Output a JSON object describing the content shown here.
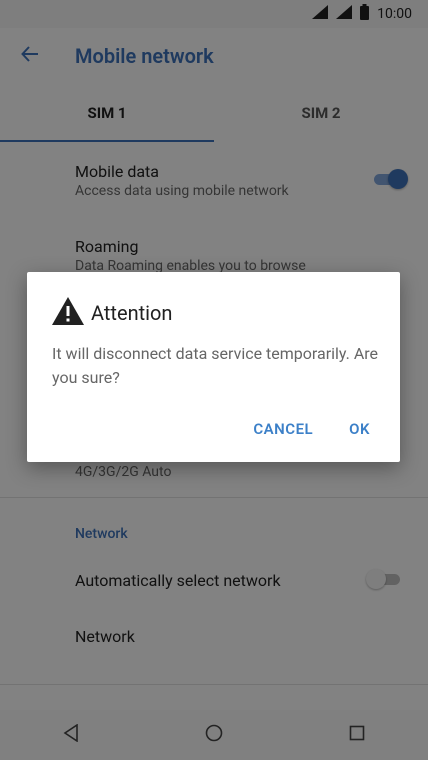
{
  "status_bar": {
    "time": "10:00",
    "icons": [
      "signal-icon",
      "signal-icon",
      "battery-icon"
    ]
  },
  "app_bar": {
    "back_icon": "arrow-left-icon",
    "title": "Mobile network"
  },
  "tabs": [
    {
      "label": "SIM 1",
      "active": true
    },
    {
      "label": "SIM 2",
      "active": false
    }
  ],
  "settings": {
    "mobile_data": {
      "title": "Mobile data",
      "subtitle": "Access data using mobile network",
      "toggle_on": true
    },
    "roaming": {
      "title": "Roaming",
      "subtitle": "Data Roaming enables you to browse"
    },
    "network_type": {
      "subtitle": "4G/3G/2G Auto"
    },
    "network_section": {
      "label": "Network"
    },
    "auto_select": {
      "title": "Automatically select network",
      "toggle_on": false
    },
    "network": {
      "title": "Network"
    }
  },
  "dialog": {
    "icon": "warning-icon",
    "title": "Attention",
    "message": "It will disconnect data service temporarily. Are you sure?",
    "cancel_label": "CANCEL",
    "ok_label": "OK"
  },
  "nav_bar": {
    "icons": [
      "back-triangle-icon",
      "home-circle-icon",
      "recents-square-icon"
    ]
  },
  "colors": {
    "accent": "#3c6fb6",
    "dialog_button": "#3c80c8",
    "toggle_on": "#3c6fb6",
    "toggle_off": "#bdbdbd"
  }
}
